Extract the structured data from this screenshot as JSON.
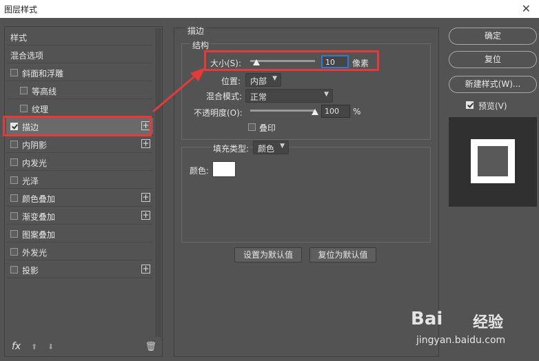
{
  "window": {
    "title": "图层样式",
    "close_glyph": "✕"
  },
  "styles_panel": {
    "items": [
      {
        "label": "样式",
        "checkbox": false,
        "plus": false,
        "checked": false,
        "indent": 0
      },
      {
        "label": "混合选项",
        "checkbox": false,
        "plus": false,
        "checked": false,
        "indent": 0
      },
      {
        "label": "斜面和浮雕",
        "checkbox": true,
        "plus": false,
        "checked": false,
        "indent": 0
      },
      {
        "label": "等高线",
        "checkbox": true,
        "plus": false,
        "checked": false,
        "indent": 1
      },
      {
        "label": "纹理",
        "checkbox": true,
        "plus": false,
        "checked": false,
        "indent": 1
      },
      {
        "label": "描边",
        "checkbox": true,
        "plus": true,
        "checked": true,
        "indent": 0,
        "selected": true
      },
      {
        "label": "内阴影",
        "checkbox": true,
        "plus": true,
        "checked": false,
        "indent": 0
      },
      {
        "label": "内发光",
        "checkbox": true,
        "plus": false,
        "checked": false,
        "indent": 0
      },
      {
        "label": "光泽",
        "checkbox": true,
        "plus": false,
        "checked": false,
        "indent": 0
      },
      {
        "label": "颜色叠加",
        "checkbox": true,
        "plus": true,
        "checked": false,
        "indent": 0
      },
      {
        "label": "渐变叠加",
        "checkbox": true,
        "plus": true,
        "checked": false,
        "indent": 0
      },
      {
        "label": "图案叠加",
        "checkbox": true,
        "plus": false,
        "checked": false,
        "indent": 0
      },
      {
        "label": "外发光",
        "checkbox": true,
        "plus": false,
        "checked": false,
        "indent": 0
      },
      {
        "label": "投影",
        "checkbox": true,
        "plus": true,
        "checked": false,
        "indent": 0
      }
    ],
    "footer": {
      "fx": "fx",
      "up": "⬆",
      "down": "⬇",
      "trash": "🗑"
    }
  },
  "stroke": {
    "section_title": "描边",
    "structure_title": "结构",
    "size_label": "大小(S):",
    "size_value": "10",
    "size_unit": "像素",
    "size_slider": 0.1,
    "position_label": "位置:",
    "position_value": "内部",
    "blend_label": "混合模式:",
    "blend_value": "正常",
    "opacity_label": "不透明度(O):",
    "opacity_value": "100",
    "opacity_unit": "%",
    "opacity_slider": 1.0,
    "overprint_label": "叠印",
    "fill_type_label": "填充类型:",
    "fill_type_value": "颜色",
    "color_label": "颜色:",
    "color_value": "#ffffff",
    "set_default_button": "设置为默认值",
    "reset_default_button": "复位为默认值"
  },
  "actions": {
    "ok": "确定",
    "reset": "复位",
    "new_style": "新建样式(W)...",
    "preview_label": "预览(V)",
    "preview_checked": true
  },
  "watermark": {
    "brand": "Bai",
    "brand_cn": "经验",
    "url": "jingyan.baidu.com"
  },
  "colors": {
    "highlight": "#e53a3a",
    "focus": "#2e7bd6",
    "panel_bg": "#535353"
  }
}
